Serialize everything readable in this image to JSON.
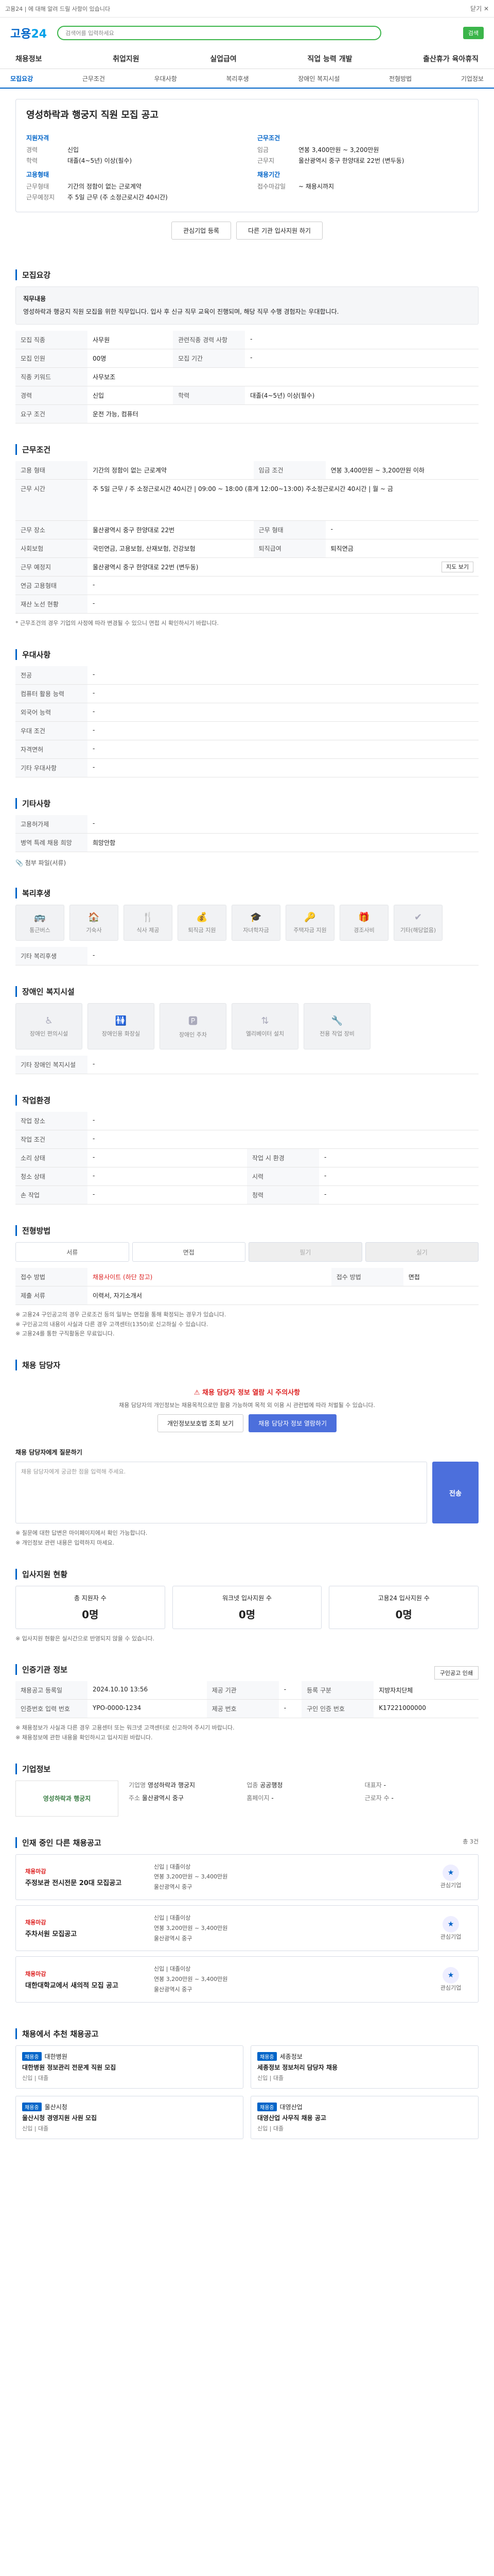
{
  "topbar": {
    "text": "고용24 | 에 대해 알려 드릴 사항이 있습니다",
    "close": "닫기 ✕"
  },
  "header": {
    "logo_main": "고용",
    "logo_num": "24",
    "search_placeholder": "검색어를 입력하세요",
    "top_button": "검색"
  },
  "gnb": [
    "채용정보",
    "취업지원",
    "실업급여",
    "직업 능력 개발",
    "출산휴가 육아휴직"
  ],
  "tabs": [
    "모집요강",
    "근무조건",
    "우대사항",
    "복리후생",
    "장애인 복지시설",
    "전형방법",
    "기업정보"
  ],
  "job": {
    "title": "영성하락과 행궁지 직원 모집 공고",
    "left_label_1": "지원자격",
    "left_items_1": [
      {
        "k": "경력",
        "v": "신입"
      },
      {
        "k": "학력",
        "v": "대졸(4~5년) 이상(필수)"
      }
    ],
    "left_label_2": "고용형태",
    "left_items_2": [
      {
        "k": "근무형태",
        "v": "기간의 정함이 없는 근로계약"
      },
      {
        "k": "근무예정지",
        "v": "주 5일 근무 (주 소정근로시간 40시간)"
      }
    ],
    "right_label_1": "근무조건",
    "right_items_1": [
      {
        "k": "임금",
        "v": "연봉 3,400만원 ~ 3,200만원"
      },
      {
        "k": "근무지",
        "v": "울산광역시 중구 한양대로 22번 (변두동)"
      }
    ],
    "right_label_2": "채용기간",
    "right_items_2": [
      {
        "k": "접수마감일",
        "v": "~ 채용시까지"
      }
    ]
  },
  "actions": [
    "관심기업 등록",
    "다른 기관 입사지원 하기"
  ],
  "recruit": {
    "title": "모집요강",
    "desc_label": "직무내용",
    "desc": "영성하락과 행궁지 직원 모집을 위한 직무입니다. 입사 후 신규 직무 교육이 진행되며, 해당 직무 수행 경험자는 우대합니다.",
    "rows": [
      {
        "k": "모집 직종",
        "v": "사무원",
        "k2": "관련직종 경력 사항",
        "v2": "-"
      },
      {
        "k": "모집 인원",
        "v": "00명",
        "k2": "모집 기간",
        "v2": "-"
      },
      {
        "k": "직종 키워드",
        "v": "사무보조",
        "k2": "",
        "v2": ""
      },
      {
        "k": "경력",
        "v": "신입",
        "k2": "학력",
        "v2": "대졸(4~5년) 이상(필수)"
      },
      {
        "k": "요구 조건",
        "v": "운전 가능, 컴퓨터",
        "k2": "",
        "v2": ""
      }
    ]
  },
  "work": {
    "title": "근무조건",
    "rows": [
      {
        "k": "고용 형태",
        "v": "기간의 정함이 없는 근로계약",
        "k2": "임금 조건",
        "v2": "연봉 3,400만원 ~ 3,200만원 이하"
      },
      {
        "k": "근무 시간",
        "v": "주 5일 근무 / 주 소정근로시간 40시간 | 09:00 ~ 18:00 (휴게 12:00~13:00) 주소정근로시간 40시간 | 월 ~ 금",
        "k2": "",
        "v2": ""
      },
      {
        "k": "근무 장소",
        "v": "울산광역시 중구 한양대로 22번",
        "k2": "근무 형태",
        "v2": "-"
      },
      {
        "k": "사회보험",
        "v": "국민연금, 고용보험, 산재보험, 건강보험",
        "k2": "퇴직급여",
        "v2": "퇴직연금"
      },
      {
        "k": "근무 예정지",
        "v": "울산광역시 중구 한양대로 22번 (변두동)",
        "k2": "",
        "v2": ""
      },
      {
        "k": "연금 고용형태",
        "v": "-",
        "k2": "",
        "v2": ""
      },
      {
        "k": "재산 노선 현황",
        "v": "-",
        "k2": "",
        "v2": ""
      }
    ],
    "note": "* 근무조건의 경우 기업의 사정에 따라 변경될 수 있으니 면접 시 확인하시기 바랍니다.",
    "map_button": "지도 보기"
  },
  "pref": {
    "title": "우대사항",
    "rows": [
      {
        "k": "전공",
        "v": "-"
      },
      {
        "k": "컴퓨터 활용 능력",
        "v": "-"
      },
      {
        "k": "외국어 능력",
        "v": "-"
      },
      {
        "k": "우대 조건",
        "v": "-"
      },
      {
        "k": "자격면허",
        "v": "-"
      },
      {
        "k": "기타 우대사항",
        "v": "-"
      }
    ]
  },
  "etc": {
    "title": "기타사항",
    "rows": [
      {
        "k": "고용허가제",
        "v": "-"
      },
      {
        "k": "병역 특례 채용 희망",
        "v": "희망안함"
      }
    ],
    "attach": "첨부 파일(서류)"
  },
  "welfare": {
    "title": "복리후생",
    "items": [
      "통근버스",
      "기숙사",
      "식사 제공",
      "퇴직금 지원",
      "자녀학자금",
      "주택자금 지원",
      "경조사비",
      "기타(해당없음)"
    ],
    "other_label": "기타 복리후생",
    "other_value": "-"
  },
  "disability": {
    "title": "장애인 복지시설",
    "items": [
      "장애인 편의시설",
      "장애인용 화장실",
      "장애인 주차",
      "엘리베이터 설치",
      "전용 작업 장비"
    ],
    "other_label": "기타 장애인 복지시설",
    "other_value": "-"
  },
  "dept": {
    "title": "작업환경",
    "rows": [
      {
        "k": "작업 장소",
        "v": "-",
        "k2": "",
        "v2": ""
      },
      {
        "k": "작업 조건",
        "v": "-",
        "k2": "",
        "v2": ""
      },
      {
        "k": "소리 상태",
        "v": "-",
        "k2": "작업 시 환경",
        "v2": "-"
      },
      {
        "k": "청소 상태",
        "v": "-",
        "k2": "시력",
        "v2": "-"
      },
      {
        "k": "손 작업",
        "v": "-",
        "k2": "청력",
        "v2": "-"
      }
    ]
  },
  "method": {
    "title": "전형방법",
    "steps": [
      "서류",
      "면접",
      "필기",
      "실기"
    ],
    "apply_k": "접수 방법",
    "apply_v": "채용사이트 (하단 참고)",
    "doc_k": "접수 방법",
    "doc_v": "면접",
    "docs_k": "제출 서류",
    "docs_v": "이력서, 자기소개서",
    "notes": [
      "※ 고용24 구인공고의 경우 근로조건 등의 일부는 면접을 통해 확정되는 경우가 있습니다.",
      "※ 구인공고의 내용이 사실과 다른 경우 고객센터(1350)로 신고하실 수 있습니다.",
      "※ 고용24를 통한 구직활동은 무료입니다."
    ]
  },
  "manager": {
    "title": "채용 담당자",
    "warn": "채용 담당자 정보 열람 시 주의사항",
    "desc": "채용 담당자의 개인정보는 채용목적으로만 활용 가능하며 목적 외 이용 시 관련법에 따라 처벌될 수 있습니다.",
    "btn1": "개인정보보호법 조회 보기",
    "btn2": "채용 담당자 정보 열람하기",
    "ask_label": "채용 담당자에게 질문하기",
    "ask_placeholder": "채용 담당자에게 궁금한 점을 입력해 주세요.",
    "send": "전송",
    "ask_notes": [
      "※ 질문에 대한 답변은 마이페이지에서 확인 가능합니다.",
      "※ 개인정보 관련 내용은 입력하지 마세요."
    ]
  },
  "status": {
    "title": "입사지원 현황",
    "cols": [
      {
        "k": "총 지원자 수",
        "v": "0명"
      },
      {
        "k": "워크넷 입사지원 수",
        "v": "0명"
      },
      {
        "k": "고용24 입사지원 수",
        "v": "0명"
      }
    ],
    "note": "※ 입사지원 현황은 실시간으로 반영되지 않을 수 있습니다."
  },
  "reg": {
    "title": "인증기관 정보",
    "btn": "구인공고 인쇄",
    "rows": [
      {
        "k": "채용공고 등록일",
        "v": "2024.10.10 13:56",
        "k2": "제공 기관",
        "v2": "-",
        "k3": "등록 구분",
        "v3": "지방자치단체"
      },
      {
        "k": "인증번호 입력 번호",
        "v": "YPO-0000-1234",
        "k2": "제공 번호",
        "v2": "-",
        "k3": "구인 인증 번호",
        "v3": "K17221000000"
      }
    ],
    "notes": [
      "※ 채용정보가 사실과 다른 경우 고용센터 또는 워크넷 고객센터로 신고하여 주시기 바랍니다.",
      "※ 채용정보에 관한 내용을 확인하시고 입사지원 바랍니다."
    ]
  },
  "company": {
    "title": "기업정보",
    "logo_text": "영성하락과 행궁지",
    "info": [
      {
        "k": "기업명",
        "v": "영성하락과 행궁지"
      },
      {
        "k": "업종",
        "v": "공공행정"
      },
      {
        "k": "대표자",
        "v": "-"
      },
      {
        "k": "주소",
        "v": "울산광역시 중구"
      },
      {
        "k": "홈페이지",
        "v": "-"
      },
      {
        "k": "근로자 수",
        "v": "-"
      }
    ]
  },
  "related": {
    "title": "인재 중인 다른 채용공고",
    "count": "총 3건",
    "items": [
      {
        "tag": "채용마감",
        "title": "주정보관 전시전문 20대 모집공고",
        "info": [
          "신입 | 대졸이상",
          "연봉 3,200만원 ~ 3,400만원",
          "울산광역시 중구"
        ],
        "label": "관심기업"
      },
      {
        "tag": "채용마감",
        "title": "주차서원 모집공고",
        "info": [
          "신입 | 대졸이상",
          "연봉 3,200만원 ~ 3,400만원",
          "울산광역시 중구"
        ],
        "label": "관심기업"
      },
      {
        "tag": "채용마감",
        "title": "대한대학교에서 새의적 모집 공고",
        "info": [
          "신입 | 대졸이상",
          "연봉 3,200만원 ~ 3,400만원",
          "울산광역시 중구"
        ],
        "label": "관심기업"
      }
    ]
  },
  "recommend": {
    "title": "채용에서 추천 채용공고",
    "items": [
      {
        "tg": "채용중",
        "co": "대한병원",
        "title": "대한병원 정보관리 전문계 직원 모집",
        "sub": "신입 | 대졸"
      },
      {
        "tg": "채용중",
        "co": "세종정보",
        "title": "세종정보 정보처리 담당자 채용",
        "sub": "신입 | 대졸"
      },
      {
        "tg": "채용중",
        "co": "울산시청",
        "title": "울산시청 경영지원 사원 모집",
        "sub": "신입 | 대졸"
      },
      {
        "tg": "채용중",
        "co": "대영산업",
        "title": "대영산업 사무직 채용 공고",
        "sub": "신입 | 대졸"
      }
    ]
  }
}
